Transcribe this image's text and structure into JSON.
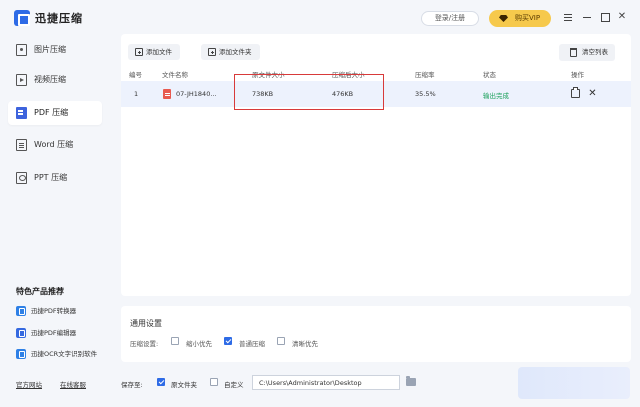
{
  "app": {
    "title": "迅捷压缩"
  },
  "header": {
    "login_label": "登录/注册",
    "vip_label": "购买VIP"
  },
  "sidebar": {
    "items": [
      {
        "label": "图片压缩",
        "icon": "image-icon"
      },
      {
        "label": "视频压缩",
        "icon": "video-icon"
      },
      {
        "label": "PDF 压缩",
        "icon": "pdf-icon",
        "active": true
      },
      {
        "label": "Word 压缩",
        "icon": "word-icon"
      },
      {
        "label": "PPT 压缩",
        "icon": "ppt-icon"
      }
    ],
    "features_title": "特色产品推荐",
    "features": [
      {
        "label": "迅捷PDF转换器"
      },
      {
        "label": "迅捷PDF编辑器"
      },
      {
        "label": "迅捷OCR文字识别软件"
      }
    ],
    "footer": {
      "official_site": "官方网站",
      "online_support": "在线客服"
    }
  },
  "toolbar": {
    "add_file": "添加文件",
    "add_folder": "添加文件夹",
    "clear_list": "清空列表"
  },
  "table": {
    "headers": {
      "index": "编号",
      "name": "文件名称",
      "original_size": "原文件大小",
      "compressed_size": "压缩后大小",
      "ratio": "压缩率",
      "status": "状态",
      "actions": "操作"
    },
    "rows": [
      {
        "index": "1",
        "name": "07-JH1840...",
        "original_size": "738KB",
        "compressed_size": "476KB",
        "ratio": "35.5%",
        "status": "输出完成"
      }
    ]
  },
  "settings": {
    "title": "通用设置",
    "compress_label": "压缩设置:",
    "options": [
      {
        "label": "缩小优先",
        "checked": false
      },
      {
        "label": "普通压缩",
        "checked": true
      },
      {
        "label": "清晰优先",
        "checked": false
      }
    ]
  },
  "save": {
    "label": "保存至:",
    "original_folder": "原文件夹",
    "original_folder_checked": true,
    "custom": "自定义",
    "custom_checked": false,
    "path": "C:\\Users\\Administrator\\Desktop"
  },
  "colors": {
    "accent": "#2e6be6",
    "vip": "#f6c94c",
    "success": "#1aa05a",
    "highlight": "#d83a3a"
  }
}
